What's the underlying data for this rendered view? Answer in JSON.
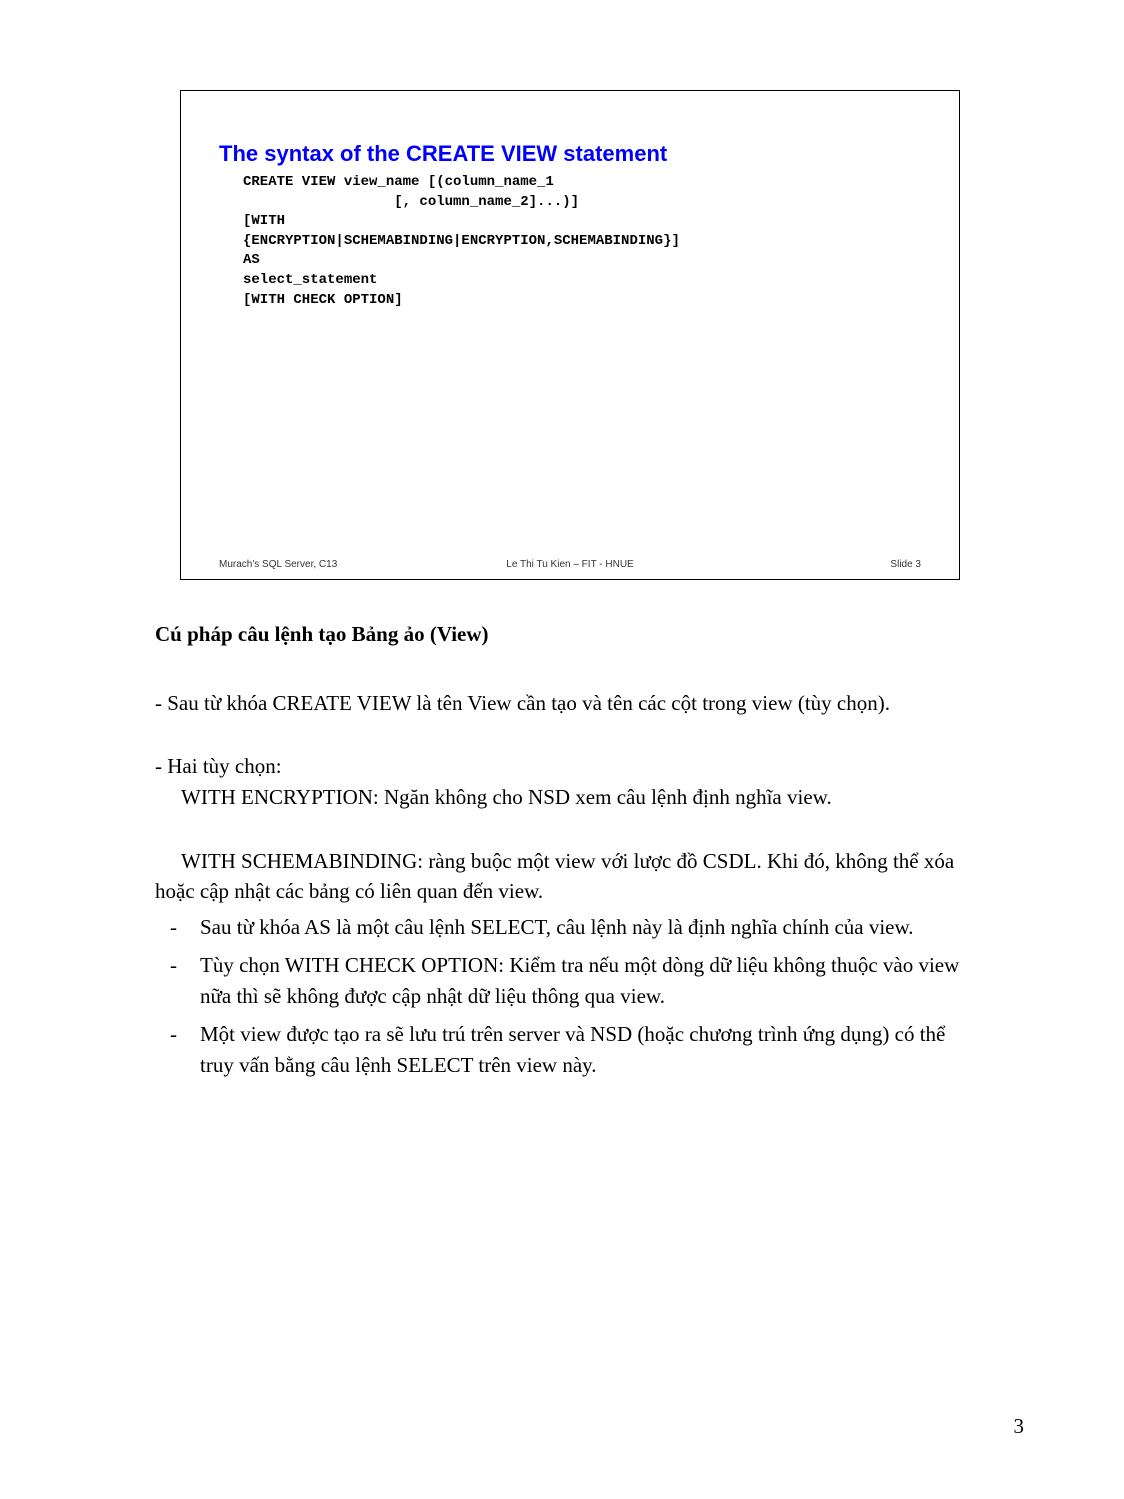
{
  "slide": {
    "title": "The syntax of the CREATE VIEW statement",
    "code": "CREATE VIEW view_name [(column_name_1\n                  [, column_name_2]...)]\n[WITH\n{ENCRYPTION|SCHEMABINDING|ENCRYPTION,SCHEMABINDING}]\nAS\nselect_statement\n[WITH CHECK OPTION]",
    "footer_left": "Murach's SQL Server, C13",
    "footer_center": "Le Thi Tu Kien – FIT - HNUE",
    "footer_right": "Slide 3"
  },
  "section_title": "Cú pháp câu lệnh tạo Bảng ảo (View)",
  "para1": "- Sau từ khóa CREATE VIEW là tên View cần tạo và tên các cột trong view (tùy chọn).",
  "para2": "- Hai tùy chọn:",
  "para3": "WITH ENCRYPTION: Ngăn không cho NSD xem câu lệnh định nghĩa view.",
  "para4": "WITH SCHEMABINDING: ràng buộc một view với lược đồ CSDL. Khi đó, không thể xóa hoặc cập nhật các bảng có liên quan đến view.",
  "bullets": [
    "Sau từ khóa AS là một câu lệnh SELECT, câu lệnh này là định nghĩa chính của view.",
    "Tùy chọn WITH CHECK OPTION: Kiểm tra nếu một dòng dữ liệu không thuộc vào view nữa thì sẽ không được cập nhật dữ liệu thông qua view.",
    "Một view được tạo ra sẽ lưu trú trên server và NSD (hoặc chương trình ứng dụng) có thể truy vấn bằng câu lệnh SELECT trên view này."
  ],
  "dash": "-",
  "page_number": "3"
}
